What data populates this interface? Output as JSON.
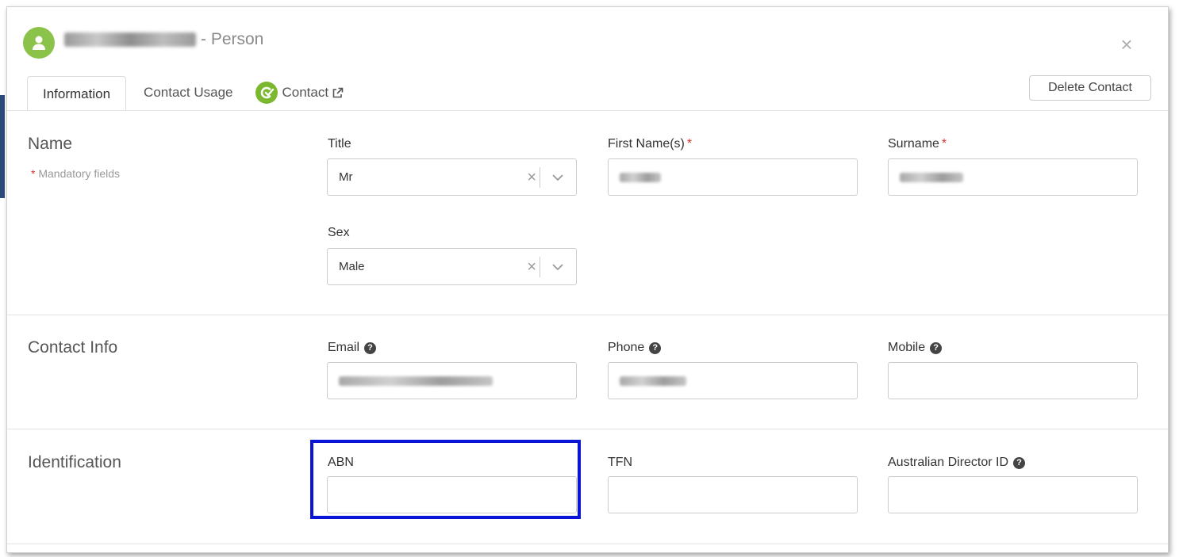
{
  "header": {
    "title_suffix": "- Person",
    "close_label": "×"
  },
  "tabs": [
    {
      "label": "Information"
    },
    {
      "label": "Contact Usage"
    },
    {
      "label": "Contact"
    }
  ],
  "actions": {
    "delete_label": "Delete Contact"
  },
  "sections": {
    "name": {
      "title": "Name",
      "mandatory_star": "*",
      "mandatory_note": "Mandatory fields",
      "title_field": {
        "label": "Title",
        "value": "Mr",
        "clear": "×"
      },
      "first_name": {
        "label": "First Name(s)",
        "required": "*"
      },
      "surname": {
        "label": "Surname",
        "required": "*"
      },
      "sex_field": {
        "label": "Sex",
        "value": "Male",
        "clear": "×"
      }
    },
    "contact_info": {
      "title": "Contact Info",
      "email": {
        "label": "Email",
        "help": "?"
      },
      "phone": {
        "label": "Phone",
        "help": "?"
      },
      "mobile": {
        "label": "Mobile",
        "help": "?",
        "value": ""
      }
    },
    "identification": {
      "title": "Identification",
      "abn": {
        "label": "ABN",
        "value": ""
      },
      "tfn": {
        "label": "TFN",
        "value": ""
      },
      "director_id": {
        "label": "Australian Director ID",
        "help": "?",
        "value": ""
      }
    }
  },
  "colors": {
    "avatar": "#8bc34a",
    "required": "#d9302c",
    "highlight": "#0a14d6",
    "brand_logo": "#7cb82f"
  }
}
